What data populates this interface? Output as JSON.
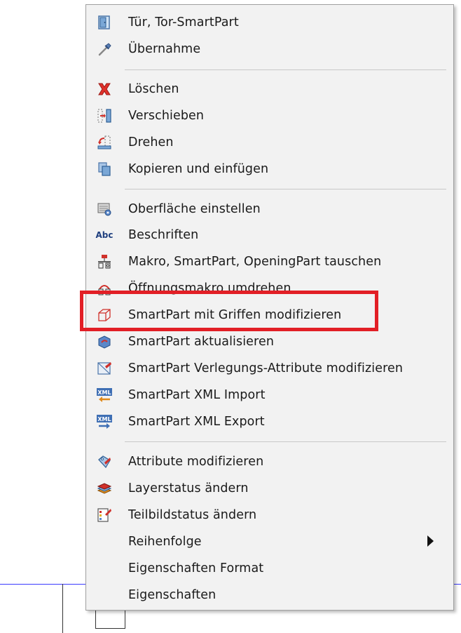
{
  "menu": {
    "items": [
      {
        "label": "Tür, Tor-SmartPart",
        "icon": "door-icon"
      },
      {
        "label": "Übernahme",
        "icon": "eyedropper-icon"
      },
      {
        "label": "Löschen",
        "icon": "delete-x-icon"
      },
      {
        "label": "Verschieben",
        "icon": "move-icon"
      },
      {
        "label": "Drehen",
        "icon": "rotate-icon"
      },
      {
        "label": "Kopieren und einfügen",
        "icon": "copy-paste-icon"
      },
      {
        "label": "Oberfläche einstellen",
        "icon": "surface-settings-icon"
      },
      {
        "label": "Beschriften",
        "icon": "abc-label-icon",
        "icon_text": "Abc"
      },
      {
        "label": "Makro, SmartPart, OpeningPart tauschen",
        "icon": "swap-macro-icon"
      },
      {
        "label": "Öffnungsmakro umdrehen",
        "icon": "flip-opening-icon"
      },
      {
        "label": "SmartPart mit Griffen modifizieren",
        "icon": "smartpart-handles-icon"
      },
      {
        "label": "SmartPart aktualisieren",
        "icon": "refresh-smartpart-icon"
      },
      {
        "label": "SmartPart Verlegungs-Attribute modifizieren",
        "icon": "placement-attributes-icon"
      },
      {
        "label": "SmartPart XML Import",
        "icon": "xml-import-icon",
        "icon_text": "XML"
      },
      {
        "label": "SmartPart XML Export",
        "icon": "xml-export-icon",
        "icon_text": "XML"
      },
      {
        "label": "Attribute modifizieren",
        "icon": "attributes-icon"
      },
      {
        "label": "Layerstatus ändern",
        "icon": "layer-status-icon"
      },
      {
        "label": "Teilbildstatus ändern",
        "icon": "drawing-file-status-icon"
      },
      {
        "label": "Reihenfolge",
        "icon": null,
        "has_submenu": true
      },
      {
        "label": "Eigenschaften Format",
        "icon": null
      },
      {
        "label": "Eigenschaften",
        "icon": null
      }
    ]
  },
  "highlighted_item": "SmartPart mit Griffen modifizieren",
  "colors": {
    "menu_bg": "#f2f2f2",
    "highlight_border": "#e21f26",
    "separator": "#c8c8c8",
    "text": "#1a1a1a",
    "background_line": "#3a3aff"
  }
}
